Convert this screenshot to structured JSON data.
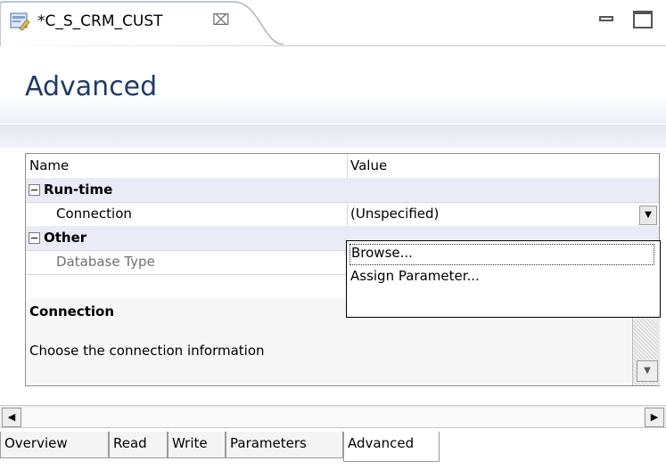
{
  "editor": {
    "tab_title": "*C_S_CRM_CUST",
    "tab_icon": "data-object-icon",
    "close_glyph": "⌧"
  },
  "header": {
    "title": "Advanced"
  },
  "properties": {
    "columns": {
      "name": "Name",
      "value": "Value"
    },
    "categories": [
      {
        "label": "Run-time",
        "properties": [
          {
            "name": "Connection",
            "value": "(Unspecified)"
          }
        ]
      },
      {
        "label": "Other",
        "properties": [
          {
            "name": "Database Type",
            "value": ""
          }
        ]
      }
    ],
    "description": {
      "title": "Connection",
      "text": "Choose the connection information"
    }
  },
  "dropdown": {
    "items": [
      "Browse...",
      "Assign Parameter..."
    ],
    "selected": "Browse..."
  },
  "page_tabs": [
    "Overview",
    "Read",
    "Write",
    "Parameters",
    "Advanced"
  ],
  "active_page_tab": "Advanced"
}
